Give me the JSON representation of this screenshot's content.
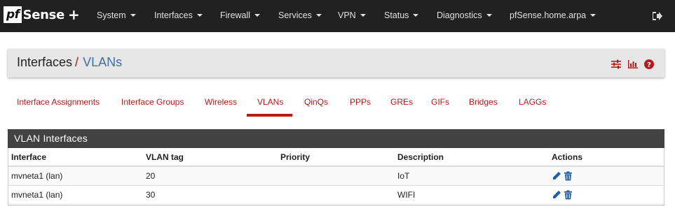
{
  "app": {
    "logo_pf": "pf",
    "logo_sense": "Sense",
    "logo_plus": "+"
  },
  "navbar": {
    "items": [
      "System",
      "Interfaces",
      "Firewall",
      "Services",
      "VPN",
      "Status",
      "Diagnostics",
      "pfSense.home.arpa"
    ],
    "logout_icon": "sign-out-icon"
  },
  "breadcrumb": {
    "section": "Interfaces",
    "separator": "/",
    "page": "VLANs",
    "icons": [
      "sliders-icon",
      "bar-chart-icon",
      "question-circle-icon"
    ]
  },
  "tabs": {
    "items": [
      "Interface Assignments",
      "Interface Groups",
      "Wireless",
      "VLANs",
      "QinQs",
      "PPPs",
      "GREs",
      "GIFs",
      "Bridges",
      "LAGGs"
    ],
    "active": "VLANs"
  },
  "panel": {
    "title": "VLAN Interfaces",
    "columns": [
      "Interface",
      "VLAN tag",
      "Priority",
      "Description",
      "Actions"
    ],
    "rows": [
      {
        "interface": "mvneta1 (lan)",
        "tag": "20",
        "priority": "",
        "description": "IoT"
      },
      {
        "interface": "mvneta1 (lan)",
        "tag": "30",
        "priority": "",
        "description": "WIFI"
      }
    ]
  },
  "colors": {
    "navbar_bg": "#212121",
    "accent_red": "#b71c1c",
    "link_blue": "#3f6ea8",
    "action_blue": "#1e5fa8",
    "panel_head": "#424242"
  }
}
